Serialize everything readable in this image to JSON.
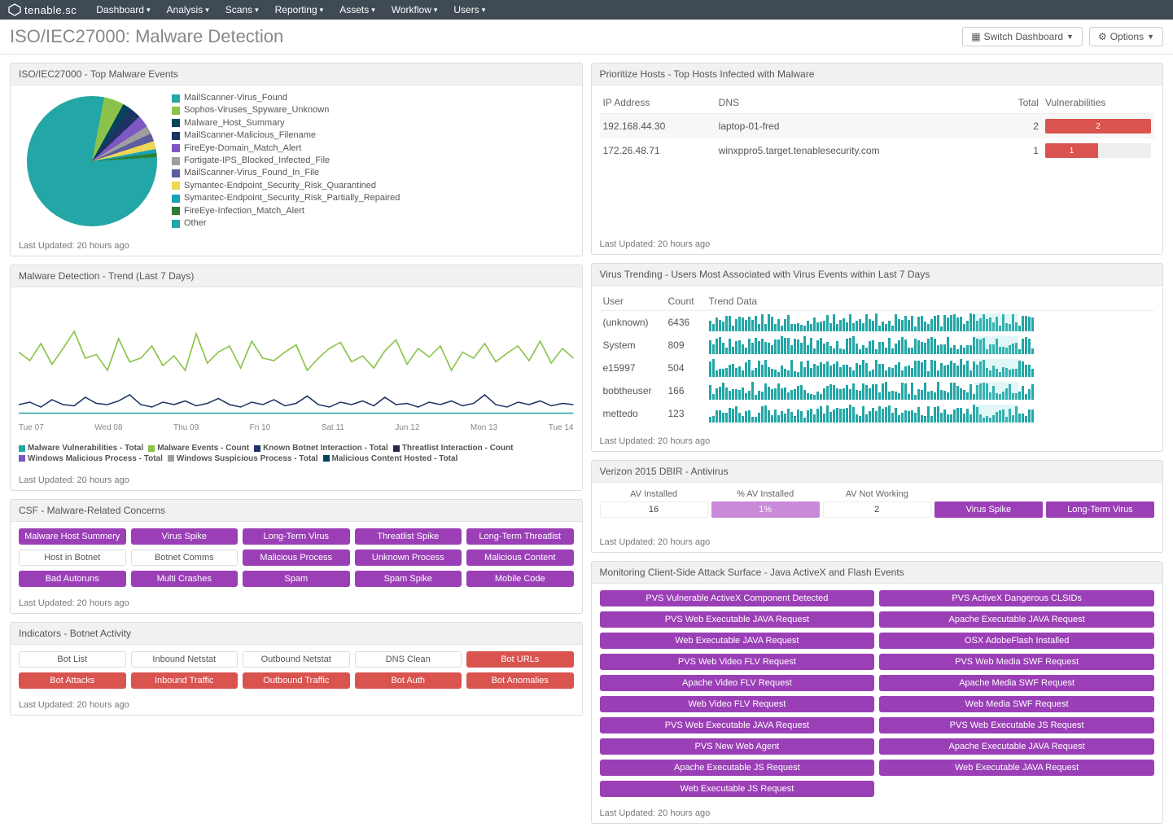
{
  "brand": "tenable.sc",
  "nav": [
    "Dashboard",
    "Analysis",
    "Scans",
    "Reporting",
    "Assets",
    "Workflow",
    "Users"
  ],
  "page_title": "ISO/IEC27000: Malware Detection",
  "buttons": {
    "switch": "Switch Dashboard",
    "options": "Options"
  },
  "updated": "Last Updated: 20 hours ago",
  "pie_panel": {
    "title": "ISO/IEC27000 - Top Malware Events",
    "legend": [
      {
        "label": "MailScanner-Virus_Found",
        "color": "#23a6a6"
      },
      {
        "label": "Sophos-Viruses_Spyware_Unknown",
        "color": "#8bc34a"
      },
      {
        "label": "Malware_Host_Summary",
        "color": "#05445b"
      },
      {
        "label": "MailScanner-Malicious_Filename",
        "color": "#1d3364"
      },
      {
        "label": "FireEye-Domain_Match_Alert",
        "color": "#7e57c2"
      },
      {
        "label": "Fortigate-IPS_Blocked_Infected_File",
        "color": "#9e9e9e"
      },
      {
        "label": "MailScanner-Virus_Found_In_File",
        "color": "#5c5c9e"
      },
      {
        "label": "Symantec-Endpoint_Security_Risk_Quarantined",
        "color": "#eed754"
      },
      {
        "label": "Symantec-Endpoint_Security_Risk_Partially_Repaired",
        "color": "#17a2b8"
      },
      {
        "label": "FireEye-Infection_Match_Alert",
        "color": "#2e7d32"
      },
      {
        "label": "Other",
        "color": "#23a6a6"
      }
    ]
  },
  "trend_panel": {
    "title": "Malware Detection - Trend (Last 7 Days)",
    "x_labels": [
      "Tue 07",
      "Wed 08",
      "Thu 09",
      "Fri 10",
      "Sat 11",
      "Jun 12",
      "Mon 13",
      "Tue 14"
    ],
    "series_legend": [
      {
        "label": "Malware Vulnerabilities - Total",
        "color": "#23a6a6"
      },
      {
        "label": "Malware Events - Count",
        "color": "#8bc34a"
      },
      {
        "label": "Known Botnet Interaction - Total",
        "color": "#1d3364"
      },
      {
        "label": "Threatlist Interaction - Count",
        "color": "#2e264c"
      },
      {
        "label": "Windows Malicious Process - Total",
        "color": "#7e57c2"
      },
      {
        "label": "Windows Suspicious Process - Total",
        "color": "#9e9e9e"
      },
      {
        "label": "Malicious Content Hosted - Total",
        "color": "#05445b"
      }
    ]
  },
  "csf_panel": {
    "title": "CSF - Malware-Related Concerns",
    "cells": [
      {
        "t": "Malware Host Summery",
        "c": "purple"
      },
      {
        "t": "Virus Spike",
        "c": "purple"
      },
      {
        "t": "Long-Term Virus",
        "c": "purple"
      },
      {
        "t": "Threatlist Spike",
        "c": "purple"
      },
      {
        "t": "Long-Term Threatlist",
        "c": "purple"
      },
      {
        "t": "Host in Botnet",
        "c": ""
      },
      {
        "t": "Botnet Comms",
        "c": ""
      },
      {
        "t": "Malicious Process",
        "c": "purple"
      },
      {
        "t": "Unknown Process",
        "c": "purple"
      },
      {
        "t": "Malicious Content",
        "c": "purple"
      },
      {
        "t": "Bad Autoruns",
        "c": "purple"
      },
      {
        "t": "Multi Crashes",
        "c": "purple"
      },
      {
        "t": "Spam",
        "c": "purple"
      },
      {
        "t": "Spam Spike",
        "c": "purple"
      },
      {
        "t": "Mobile Code",
        "c": "purple"
      }
    ]
  },
  "botnet_panel": {
    "title": "Indicators - Botnet Activity",
    "cells": [
      {
        "t": "Bot List",
        "c": ""
      },
      {
        "t": "Inbound Netstat",
        "c": ""
      },
      {
        "t": "Outbound Netstat",
        "c": ""
      },
      {
        "t": "DNS Clean",
        "c": ""
      },
      {
        "t": "Bot URLs",
        "c": "red"
      },
      {
        "t": "Bot Attacks",
        "c": "red"
      },
      {
        "t": "Inbound Traffic",
        "c": "red"
      },
      {
        "t": "Outbound Traffic",
        "c": "red"
      },
      {
        "t": "Bot Auth",
        "c": "red"
      },
      {
        "t": "Bot Anomalies",
        "c": "red"
      }
    ]
  },
  "hosts_panel": {
    "title": "Prioritize Hosts - Top Hosts Infected with Malware",
    "columns": [
      "IP Address",
      "DNS",
      "Total",
      "Vulnerabilities"
    ],
    "rows": [
      {
        "ip": "192.168.44.30",
        "dns": "laptop-01-fred",
        "total": "2",
        "vuln": "2",
        "pct": 100
      },
      {
        "ip": "172.26.48.71",
        "dns": "winxppro5.target.tenablesecurity.com",
        "total": "1",
        "vuln": "1",
        "pct": 50
      }
    ]
  },
  "virus_trend_panel": {
    "title": "Virus Trending - Users Most Associated with Virus Events within Last 7 Days",
    "columns": [
      "User",
      "Count",
      "Trend Data"
    ],
    "rows": [
      {
        "user": "(unknown)",
        "count": "6436"
      },
      {
        "user": "System",
        "count": "809"
      },
      {
        "user": "e15997",
        "count": "504"
      },
      {
        "user": "bobtheuser",
        "count": "166"
      },
      {
        "user": "mettedo",
        "count": "123"
      }
    ]
  },
  "dbir_panel": {
    "title": "Verizon 2015 DBIR - Antivirus",
    "heads": [
      "AV Installed",
      "% AV Installed",
      "AV Not Working",
      "",
      ""
    ],
    "cells": [
      {
        "t": "16",
        "c": ""
      },
      {
        "t": "1%",
        "c": "lpurple"
      },
      {
        "t": "2",
        "c": ""
      },
      {
        "t": "Virus Spike",
        "c": "purple"
      },
      {
        "t": "Long-Term Virus",
        "c": "purple"
      }
    ]
  },
  "attack_panel": {
    "title": "Monitoring Client-Side Attack Surface - Java ActiveX and Flash Events",
    "cells": [
      "PVS Vulnerable ActiveX Component Detected",
      "PVS ActiveX Dangerous CLSIDs",
      "PVS Web Executable JAVA Request",
      "Apache Executable JAVA Request",
      "Web Executable JAVA Request",
      "OSX AdobeFlash Installed",
      "PVS Web Video FLV Request",
      "PVS Web Media SWF Request",
      "Apache Video FLV Request",
      "Apache Media SWF Request",
      "Web Video FLV Request",
      "Web Media SWF Request",
      "PVS Web Executable JAVA Request",
      "PVS Web Executable JS Request",
      "PVS New Web Agent",
      "Apache Executable JAVA Request",
      "Apache Executable JS Request",
      "Web Executable JAVA Request",
      "Web Executable JS Request"
    ]
  },
  "chart_data": {
    "pie": {
      "type": "pie",
      "title": "ISO/IEC27000 - Top Malware Events",
      "slices": [
        {
          "name": "MailScanner-Virus_Found",
          "pct": 78,
          "color": "#23a6a6"
        },
        {
          "name": "Sophos-Viruses_Spyware_Unknown",
          "pct": 5,
          "color": "#8bc34a"
        },
        {
          "name": "Malware_Host_Summary",
          "pct": 2,
          "color": "#05445b"
        },
        {
          "name": "MailScanner-Malicious_Filename",
          "pct": 3,
          "color": "#1d3364"
        },
        {
          "name": "FireEye-Domain_Match_Alert",
          "pct": 3,
          "color": "#7e57c2"
        },
        {
          "name": "Fortigate-IPS_Blocked_Infected_File",
          "pct": 2,
          "color": "#9e9e9e"
        },
        {
          "name": "MailScanner-Virus_Found_In_File",
          "pct": 2,
          "color": "#5c5c9e"
        },
        {
          "name": "Symantec-Endpoint_Security_Risk_Quarantined",
          "pct": 2,
          "color": "#eed754"
        },
        {
          "name": "Symantec-Endpoint_Security_Risk_Partially_Repaired",
          "pct": 1,
          "color": "#17a2b8"
        },
        {
          "name": "FireEye-Infection_Match_Alert",
          "pct": 1,
          "color": "#2e7d32"
        },
        {
          "name": "Other",
          "pct": 1,
          "color": "#23a6a6"
        }
      ]
    },
    "trend": {
      "type": "line",
      "title": "Malware Detection - Trend (Last 7 Days)",
      "x": [
        "Tue 07",
        "Wed 08",
        "Thu 09",
        "Fri 10",
        "Sat 11",
        "Jun 12",
        "Mon 13",
        "Tue 14"
      ],
      "ylim": [
        0,
        100
      ],
      "series": [
        {
          "name": "Malware Events - Count",
          "color": "#8bc34a",
          "values": [
            55,
            48,
            62,
            45,
            58,
            72,
            50,
            53,
            40,
            66,
            47,
            50,
            60,
            44,
            52,
            40,
            70,
            46,
            55,
            60,
            42,
            64,
            50,
            48,
            55,
            61,
            40,
            50,
            58,
            63,
            47,
            52,
            42,
            56,
            65,
            45,
            58,
            51,
            60,
            40,
            55,
            50,
            62,
            47,
            54,
            60,
            48,
            64,
            46,
            58,
            50
          ]
        },
        {
          "name": "Known Botnet Interaction - Total",
          "color": "#1d3364",
          "values": [
            12,
            14,
            10,
            16,
            12,
            11,
            18,
            13,
            12,
            15,
            20,
            12,
            10,
            14,
            12,
            15,
            11,
            13,
            17,
            12,
            10,
            14,
            12,
            16,
            11,
            13,
            19,
            12,
            10,
            14,
            12,
            15,
            11,
            18,
            12,
            13,
            10,
            14,
            12,
            15,
            11,
            13,
            20,
            12,
            10,
            14,
            12,
            15,
            11,
            13,
            12
          ]
        },
        {
          "name": "Malware Vulnerabilities - Total",
          "color": "#23a6a6",
          "values": [
            5,
            5,
            5,
            5,
            5,
            5,
            5,
            5,
            5,
            5,
            5,
            5,
            5,
            5,
            5,
            5,
            5,
            5,
            5,
            5,
            5,
            5,
            5,
            5,
            5,
            5,
            5,
            5,
            5,
            5,
            5,
            5,
            5,
            5,
            5,
            5,
            5,
            5,
            5,
            5,
            5,
            5,
            5,
            5,
            5,
            5,
            5,
            5,
            5,
            5,
            5
          ]
        }
      ]
    }
  }
}
